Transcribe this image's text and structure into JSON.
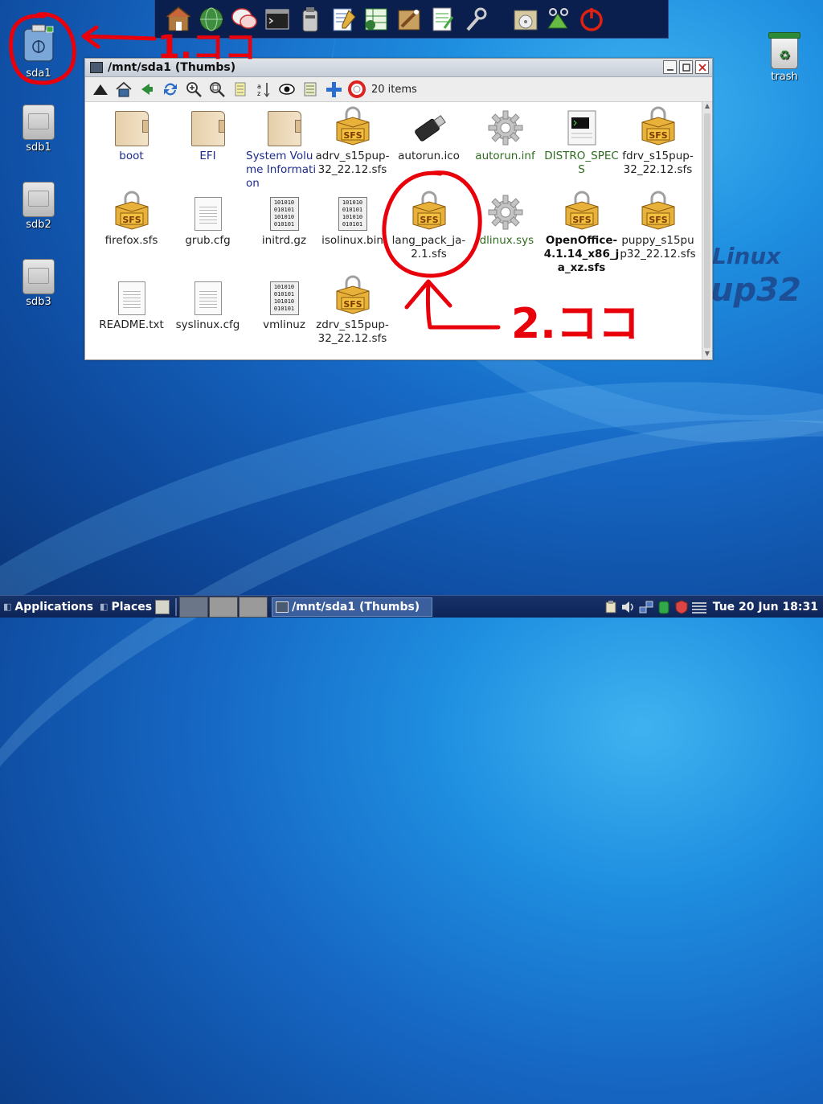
{
  "launcher": {
    "icons": [
      "home-icon",
      "browser-globe-icon",
      "chat-icon",
      "terminal-icon",
      "usb-drive-icon",
      "text-editor-icon",
      "spreadsheet-icon",
      "paint-icon",
      "notes-icon",
      "settings-wrench-icon",
      "cd-burner-icon",
      "screenshot-icon",
      "power-icon"
    ]
  },
  "desktop": {
    "icons": [
      {
        "label": "sda1"
      },
      {
        "label": "sdb1"
      },
      {
        "label": "sdb2"
      },
      {
        "label": "sdb3"
      },
      {
        "label": "trash"
      }
    ],
    "brand_line1": "Linux",
    "brand_line2": "up32"
  },
  "window": {
    "title": "/mnt/sda1 (Thumbs)",
    "item_count": "20 items",
    "toolbar_icons": [
      "up-icon",
      "home-icon",
      "back-icon",
      "refresh-icon",
      "zoom-in-icon",
      "zoom-fit-icon",
      "list-view-icon",
      "sort-icon",
      "show-hidden-icon",
      "details-view-icon",
      "new-icon",
      "help-icon"
    ],
    "files": [
      {
        "name": "boot",
        "type": "folder",
        "style": "blue"
      },
      {
        "name": "EFI",
        "type": "folder",
        "style": "blue"
      },
      {
        "name": "System Volume Information",
        "type": "folder",
        "style": "blue"
      },
      {
        "name": "adrv_s15pup-32_22.12.sfs",
        "type": "sfs",
        "style": ""
      },
      {
        "name": "autorun.ico",
        "type": "usb",
        "style": ""
      },
      {
        "name": "autorun.inf",
        "type": "gear",
        "style": "green"
      },
      {
        "name": "DISTRO_SPECS",
        "type": "script",
        "style": "green"
      },
      {
        "name": "fdrv_s15pup-32_22.12.sfs",
        "type": "sfs",
        "style": ""
      },
      {
        "name": "firefox.sfs",
        "type": "sfs",
        "style": ""
      },
      {
        "name": "grub.cfg",
        "type": "doc",
        "style": ""
      },
      {
        "name": "initrd.gz",
        "type": "bin",
        "style": ""
      },
      {
        "name": "isolinux.bin",
        "type": "bin",
        "style": ""
      },
      {
        "name": "lang_pack_ja-2.1.sfs",
        "type": "sfs",
        "style": ""
      },
      {
        "name": "ldlinux.sys",
        "type": "gear",
        "style": "green"
      },
      {
        "name": "OpenOffice-4.1.14_x86_ja_xz.sfs",
        "type": "sfs",
        "style": "bold"
      },
      {
        "name": "puppy_s15pup32_22.12.sfs",
        "type": "sfs",
        "style": ""
      },
      {
        "name": "README.txt",
        "type": "doc",
        "style": ""
      },
      {
        "name": "syslinux.cfg",
        "type": "doc",
        "style": ""
      },
      {
        "name": "vmlinuz",
        "type": "bin",
        "style": ""
      },
      {
        "name": "zdrv_s15pup-32_22.12.sfs",
        "type": "sfs",
        "style": ""
      }
    ],
    "binary_text": "101010\n010101\n101010\n010101",
    "sfs_badge": "SFS"
  },
  "annotations": {
    "note1": "1.ココ",
    "note2": "2.ココ",
    "color": "#e8000b"
  },
  "taskbar": {
    "applications_label": "Applications",
    "places_label": "Places",
    "task_title": "/mnt/sda1 (Thumbs)",
    "clock": "Tue 20 Jun 18:31"
  }
}
